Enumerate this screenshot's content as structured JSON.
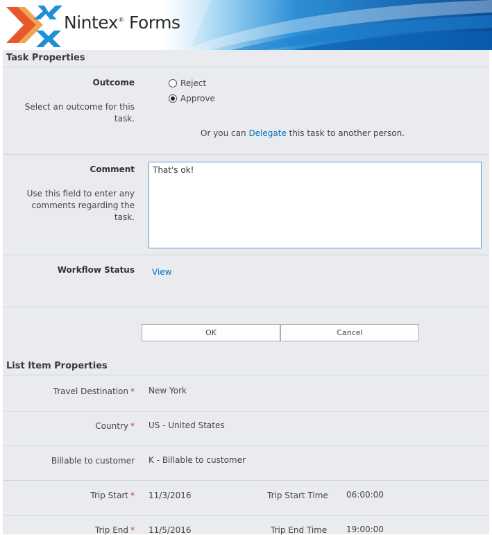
{
  "brand": {
    "name": "Nintex",
    "reg": "®",
    "product": " Forms"
  },
  "task_properties": {
    "header": "Task Properties",
    "outcome": {
      "label": "Outcome",
      "description": "Select an outcome for this task.",
      "options": [
        {
          "label": "Reject",
          "checked": false
        },
        {
          "label": "Approve",
          "checked": true
        }
      ],
      "delegate_prefix": "Or you can ",
      "delegate_link": "Delegate",
      "delegate_suffix": " this task to another person."
    },
    "comment": {
      "label": "Comment",
      "description": "Use this field to enter any comments regarding the task.",
      "value": "That's ok!"
    },
    "workflow_status": {
      "label": "Workflow Status",
      "link": "View"
    }
  },
  "buttons": {
    "ok": "OK",
    "cancel": "Cancel"
  },
  "list_item_properties": {
    "header": "List Item Properties",
    "required_marker": "*",
    "fields": {
      "travel_destination": {
        "label": "Travel Destination",
        "value": "New York"
      },
      "country": {
        "label": "Country",
        "value": "US - United States"
      },
      "billable": {
        "label": "Billable to customer",
        "value": "K - Billable to customer"
      },
      "trip_start": {
        "label": "Trip Start",
        "value": "11/3/2016"
      },
      "trip_start_time": {
        "label": "Trip Start Time",
        "value": "06:00:00"
      },
      "trip_end": {
        "label": "Trip End",
        "value": "11/5/2016"
      },
      "trip_end_time": {
        "label": "Trip End Time",
        "value": "19:00:00"
      }
    }
  },
  "colors": {
    "accent": "#0072c6",
    "form_bg": "#e9ebee",
    "required": "#c0392b",
    "banner_blue": "#0a5fb4"
  }
}
